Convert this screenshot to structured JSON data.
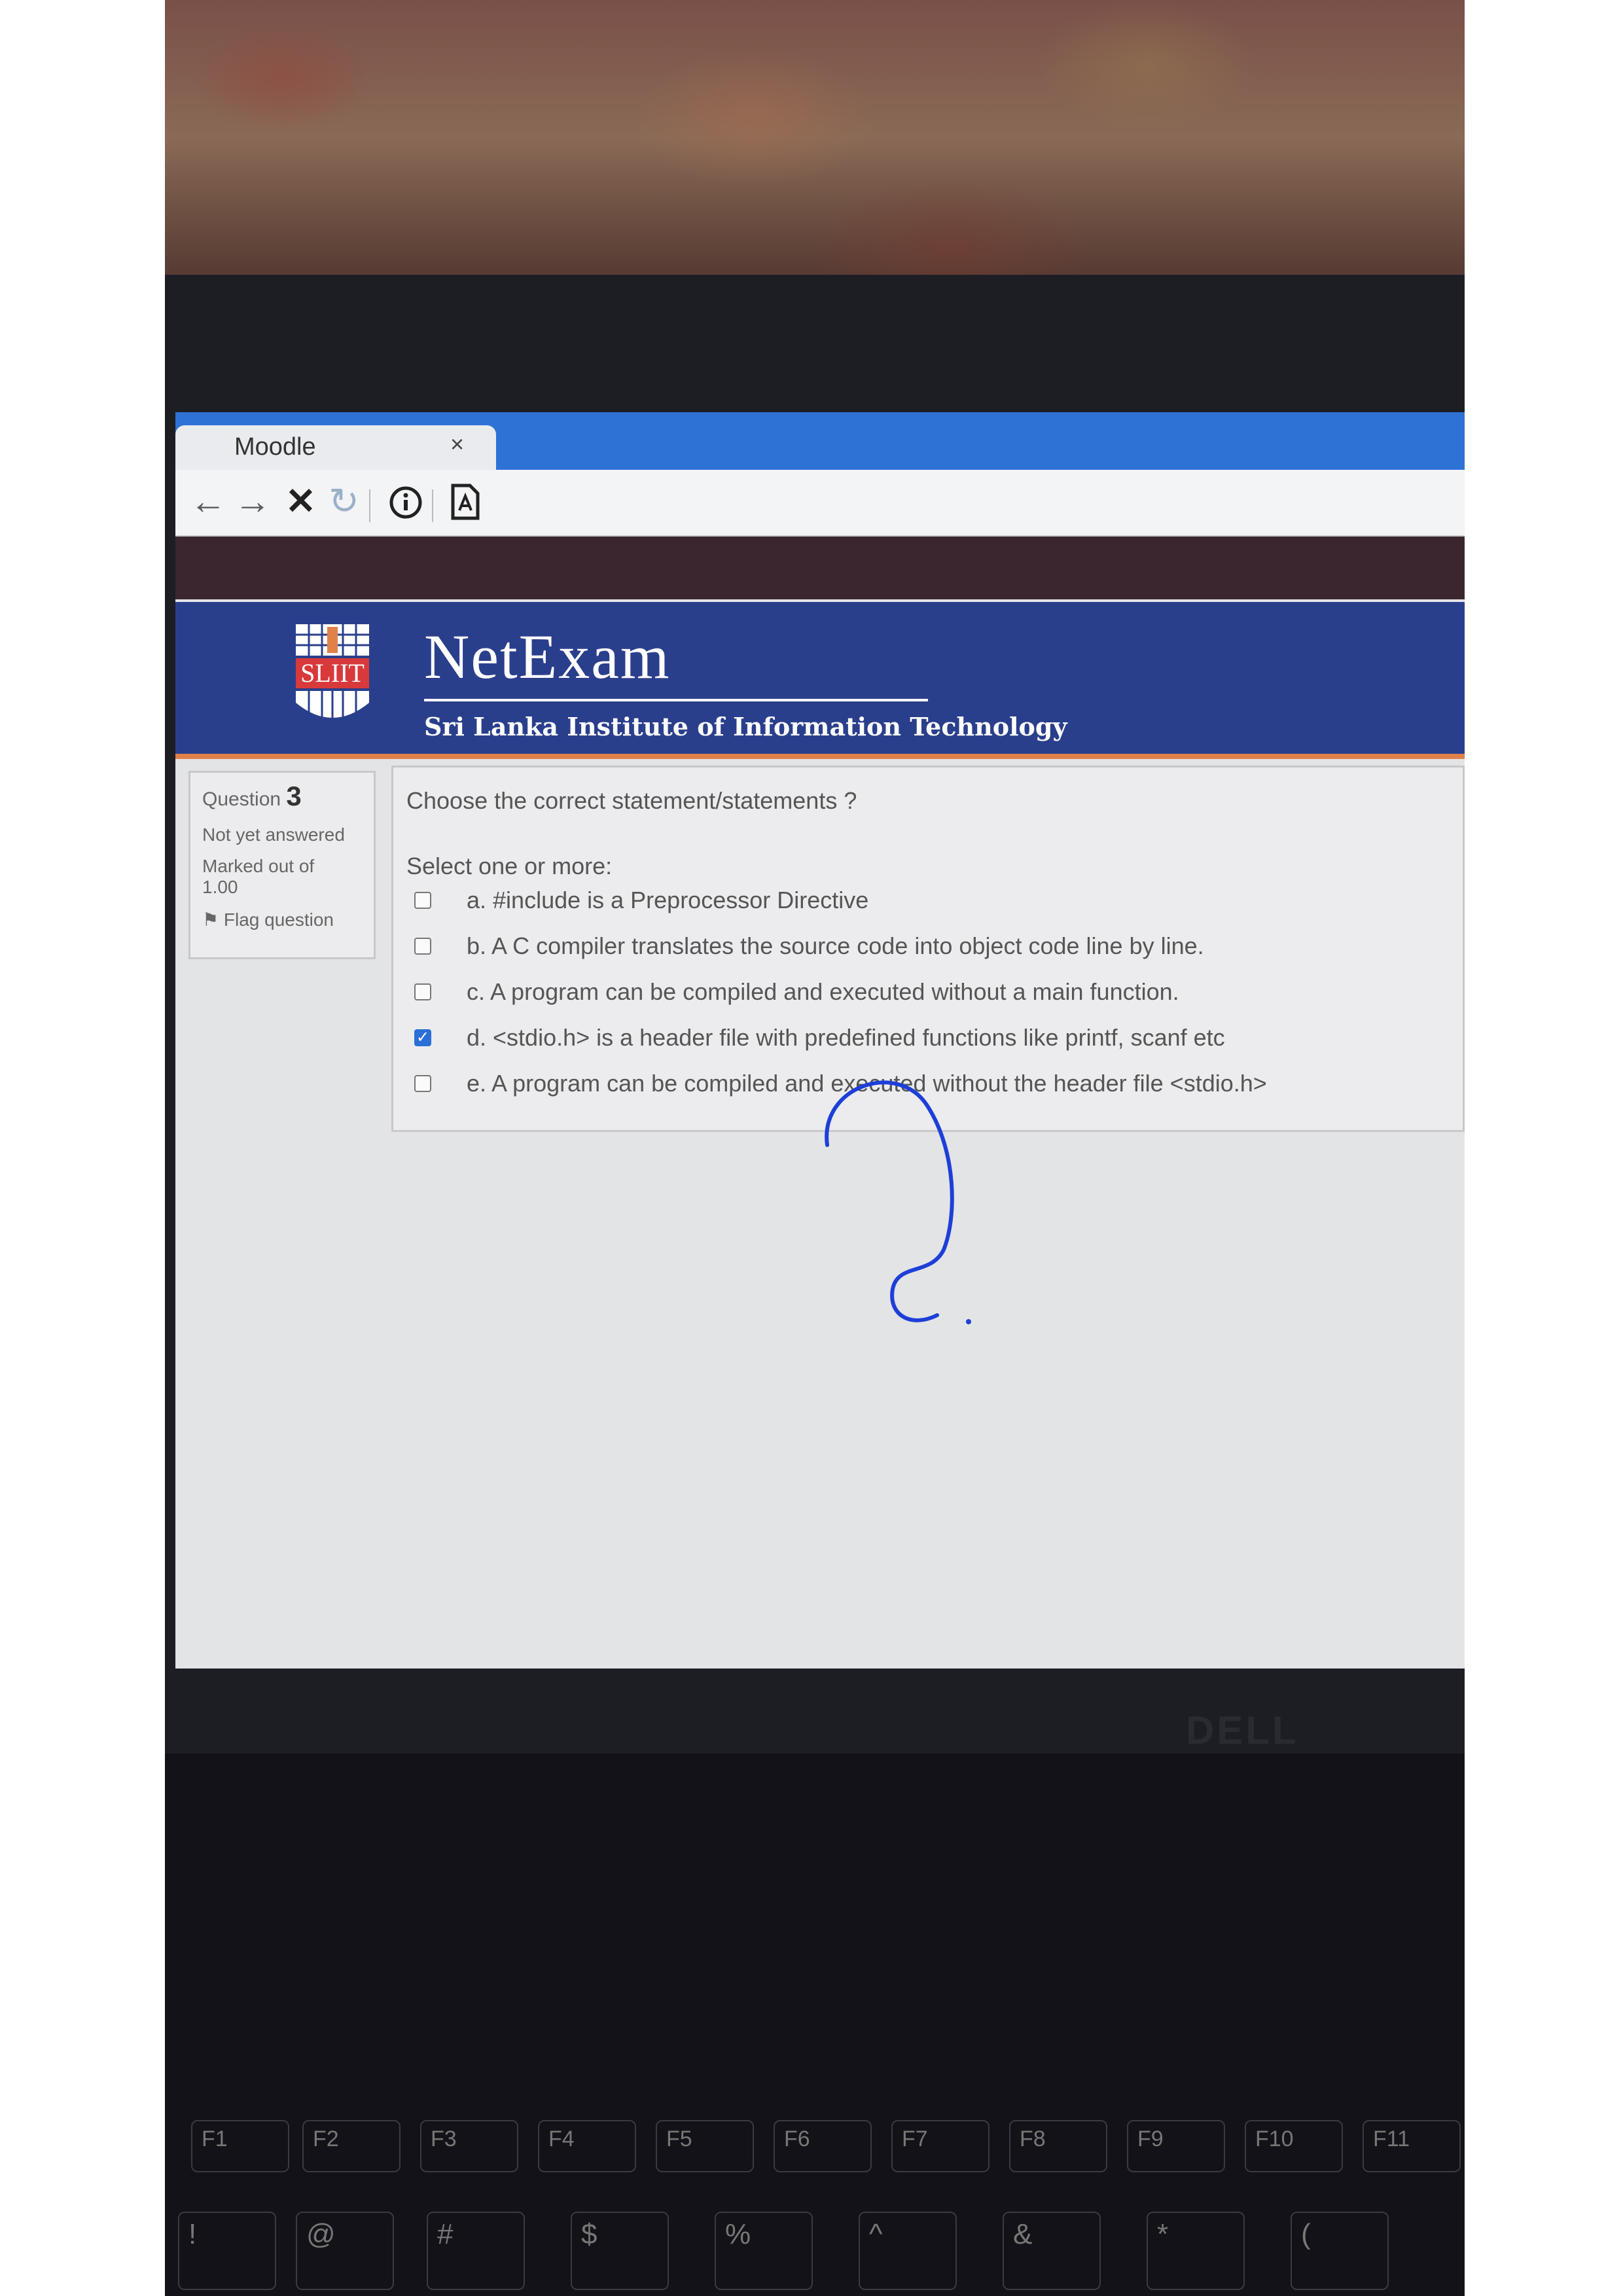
{
  "browser": {
    "tab_title": "Moodle",
    "tab_close": "×",
    "nav_icons": [
      "back-icon",
      "forward-icon",
      "stop-icon",
      "reload-icon",
      "info-icon",
      "pdf-icon"
    ]
  },
  "banner": {
    "logo_text": "SLIIT",
    "brand": "NetExam",
    "subtitle": "Sri Lanka Institute of Information Technology"
  },
  "question_info": {
    "label": "Question",
    "number": "3",
    "status": "Not yet answered",
    "marked_label": "Marked out of",
    "marks": "1.00",
    "flag_label": "Flag question"
  },
  "question": {
    "text": "Choose the correct statement/statements ?",
    "prompt": "Select one or more:",
    "options": [
      {
        "label": "a. #include is a Preprocessor Directive",
        "checked": false
      },
      {
        "label": "b. A  C compiler translates the source code into object code line by line.",
        "checked": false
      },
      {
        "label": "c. A program can be compiled and executed without a main function.",
        "checked": false
      },
      {
        "label": "d. <stdio.h> is a header file with predefined functions like printf, scanf etc",
        "checked": true
      },
      {
        "label": "e. A program can be compiled and executed without the header file <stdio.h>",
        "checked": false
      }
    ]
  },
  "keyboard": {
    "keys": [
      "F1",
      "F2",
      "F3",
      "F4",
      "F5",
      "F6",
      "F7",
      "F8",
      "F9",
      "F10",
      "F11",
      "!",
      "@",
      "#",
      "$",
      "%",
      "^",
      "&",
      "*",
      "("
    ]
  },
  "laptop_brand": "DELL",
  "colors": {
    "tab_bar": "#2f72d6",
    "banner": "#2a3f8c",
    "banner_accent": "#e0814a",
    "checkbox_checked": "#2a6fd6",
    "scribble": "#1d3fd8"
  }
}
